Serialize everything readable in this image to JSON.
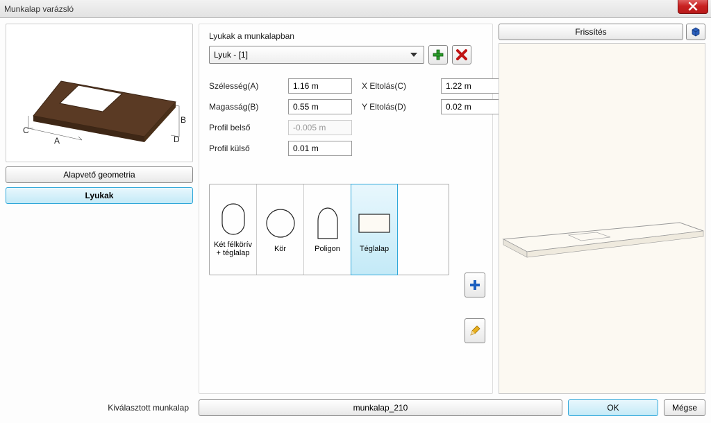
{
  "title": "Munkalap varázsló",
  "left": {
    "nav1": "Alapvető geometria",
    "nav2": "Lyukak"
  },
  "center": {
    "section_label": "Lyukak a munkalapban",
    "combo_selected": "Lyuk - [1]",
    "params": {
      "width_label": "Szélesség(A)",
      "width_value": "1.16 m",
      "height_label": "Magasság(B)",
      "height_value": "0.55 m",
      "xoff_label": "X Eltolás(C)",
      "xoff_value": "1.22 m",
      "yoff_label": "Y Eltolás(D)",
      "yoff_value": "0.02 m",
      "inner_label": "Profil belső",
      "inner_value": "-0.005 m",
      "outer_label": "Profil külső",
      "outer_value": "0.01 m"
    },
    "shapes": {
      "s1": "Két félkörív + téglalap",
      "s2": "Kör",
      "s3": "Poligon",
      "s4": "Téglalap"
    }
  },
  "right": {
    "refresh": "Frissítés"
  },
  "bottom": {
    "selected_label": "Kiválasztott munkalap",
    "selected_value": "munkalap_210",
    "ok": "OK",
    "cancel": "Mégse"
  }
}
